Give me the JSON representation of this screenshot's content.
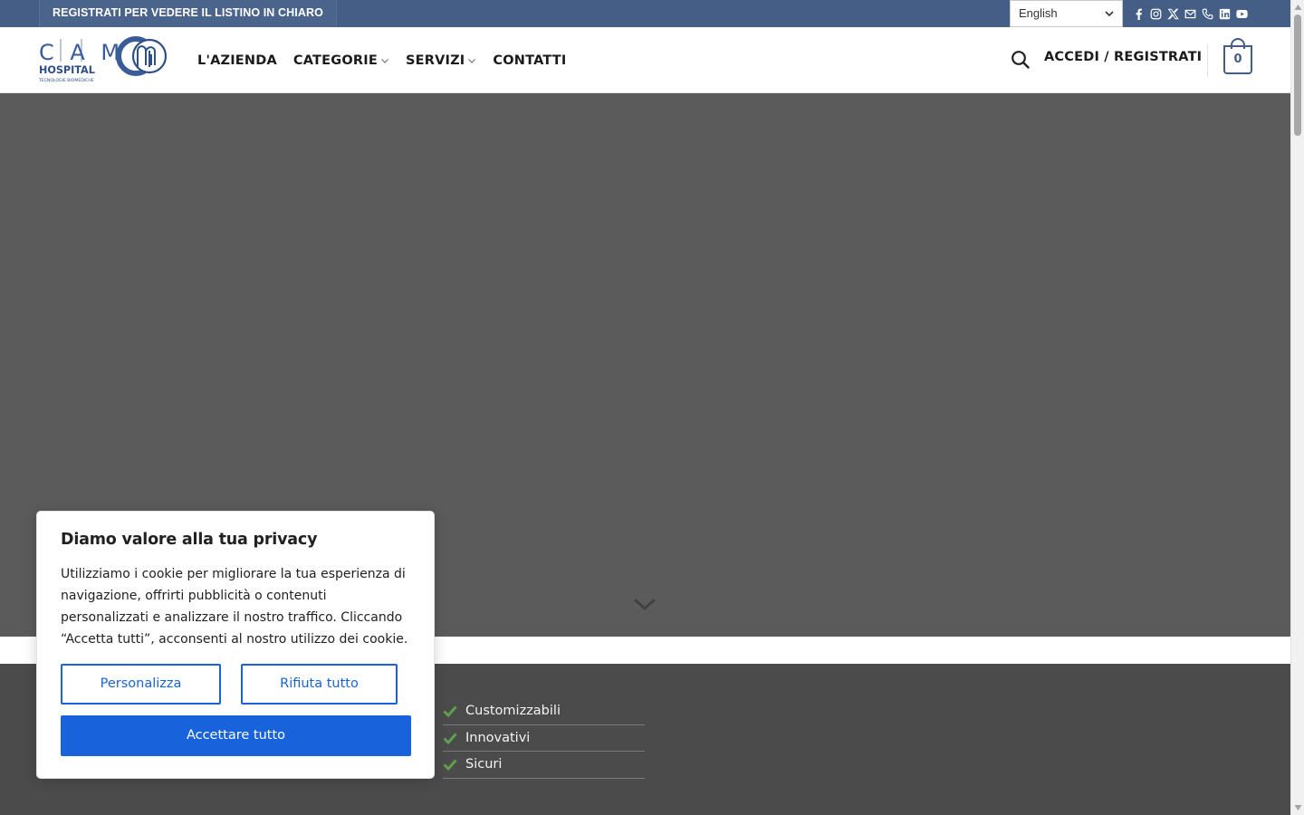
{
  "topbar": {
    "promo_text": "REGISTRATI PER VEDERE IL LISTINO IN CHIARO",
    "language": "English",
    "socials": [
      "facebook-icon",
      "instagram-icon",
      "x-icon",
      "email-icon",
      "phone-icon",
      "linkedin-icon",
      "youtube-icon"
    ]
  },
  "header": {
    "logo": {
      "line1": "C A M",
      "line2": "HOSPITAL",
      "line3": "TECNOLOGIE BIOMEDICHE"
    },
    "nav": [
      {
        "label": "L'AZIENDA",
        "has_dropdown": false
      },
      {
        "label": "CATEGORIE",
        "has_dropdown": true
      },
      {
        "label": "SERVIZI",
        "has_dropdown": true
      },
      {
        "label": "CONTATTI",
        "has_dropdown": false
      }
    ],
    "account_label": "ACCEDI / REGISTRATI",
    "cart_count": "0"
  },
  "features": [
    {
      "label": "Customizzabili"
    },
    {
      "label": "Innovativi"
    },
    {
      "label": "Sicuri"
    }
  ],
  "cookie": {
    "title": "Diamo valore alla tua privacy",
    "text": "Utilizziamo i cookie per migliorare la tua esperienza di navigazione, offrirti pubblicità o contenuti personalizzati e analizzare il nostro traffico. Cliccando “Accetta tutti”, acconsenti al nostro utilizzo dei cookie.",
    "customize_label": "Personalizza",
    "reject_label": "Rifiuta tutto",
    "accept_label": "Accettare tutto"
  },
  "colors": {
    "brand": "#445e86",
    "accent": "#1863dc",
    "check": "#5ea04a"
  }
}
